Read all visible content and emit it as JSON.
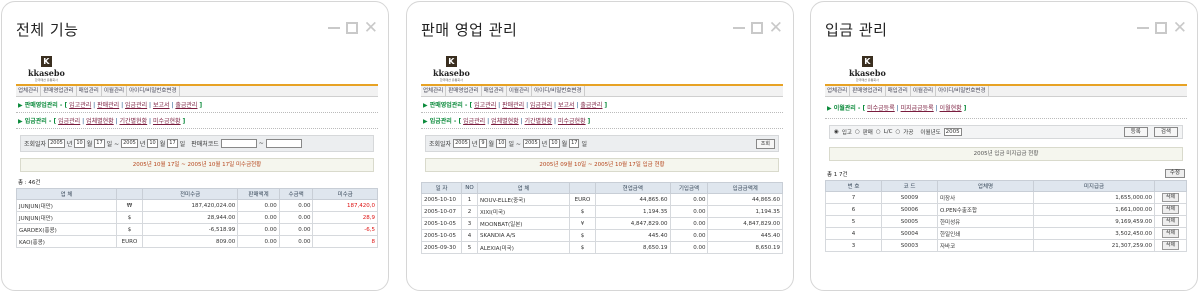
{
  "cards": [
    {
      "title": "전체 기능"
    },
    {
      "title": "판매 영업 관리"
    },
    {
      "title": "입금 관리"
    }
  ],
  "logo": {
    "mark": "K",
    "name": "kkasebo",
    "sub": "한국패션 유통회사"
  },
  "card1": {
    "menu": [
      "업체관리",
      "판매영업관리",
      "매입관리",
      "이월관리",
      "아이디/비밀번호변경"
    ],
    "nav1": {
      "prefix": "▶ 판매영업관리 - [",
      "items": [
        "입고관리",
        "판매관리",
        "입금관리",
        "보고서",
        "출금관리"
      ],
      "suffix": "]"
    },
    "nav2": {
      "prefix": "▶ 입금관리 - [",
      "items": [
        "입금관리",
        "업체별현황",
        "기간별현황",
        "미수금현황"
      ],
      "suffix": "]"
    },
    "filter": {
      "label": "조회일자",
      "y1": "2005",
      "m1": "10",
      "d1": "17",
      "y2": "2005",
      "m2": "10",
      "d2": "17",
      "code_label": "판매처코드",
      "tilde": "~"
    },
    "status": "2005년 10월 17일 ~ 2005년 10월 17일 미수금현황",
    "count": "총 : 46건",
    "columns": [
      "업 체",
      "",
      "전미수금",
      "판매액계",
      "수금액",
      "미수금"
    ],
    "rows": [
      [
        "JUNJUN(대만)",
        "₩",
        "187,420,024.00",
        "0.00",
        "0.00",
        "187,420,0"
      ],
      [
        "JUNJUN(대만)",
        "$",
        "28,944.00",
        "0.00",
        "0.00",
        "28,9"
      ],
      [
        "GARDEX(홍콩)",
        "$",
        "-6,518.99",
        "0.00",
        "0.00",
        "-6,5"
      ],
      [
        "KAO(홍콩)",
        "EURO",
        "809.00",
        "0.00",
        "0.00",
        "8"
      ]
    ]
  },
  "card2": {
    "menu": [
      "업체관리",
      "판매영업관리",
      "매입관리",
      "이월관리",
      "아이디/비밀번호변경"
    ],
    "nav1": {
      "prefix": "▶ 판매영업관리 - [",
      "items": [
        "입고관리",
        "판매관리",
        "입금관리",
        "보고서",
        "출금관리"
      ],
      "suffix": "]"
    },
    "nav2": {
      "prefix": "▶ 입금관리 - [",
      "items": [
        "입금관리",
        "업체별현황",
        "기간별현황",
        "미수금현황"
      ],
      "suffix": "]"
    },
    "filter": {
      "label": "조회일자",
      "y1": "2005",
      "m1": "9",
      "d1": "10",
      "y2": "2005",
      "m2": "10",
      "d2": "17",
      "btn": "조회"
    },
    "status": "2005년 09월 10일 ~ 2005년 10월 17일 입금 현황",
    "columns": [
      "일 자",
      "NO",
      "업 체",
      "",
      "현업금액",
      "기입금액",
      "입금금액계"
    ],
    "rows": [
      [
        "2005-10-10",
        "1",
        "NOUV-ELLE(중국)",
        "EURO",
        "44,865.60",
        "0.00",
        "44,865.60"
      ],
      [
        "2005-10-07",
        "2",
        "XIXI(미국)",
        "$",
        "1,194.35",
        "0.00",
        "1,194.35"
      ],
      [
        "2005-10-05",
        "3",
        "MOONBAT(일본)",
        "¥",
        "4,847,829.00",
        "0.00",
        "4,847,829.00"
      ],
      [
        "2005-10-05",
        "4",
        "SKANDIA A/S",
        "$",
        "445.40",
        "0.00",
        "445.40"
      ],
      [
        "2005-09-30",
        "5",
        "ALEXIA(미국)",
        "$",
        "8,650.19",
        "0.00",
        "8,650.19"
      ]
    ]
  },
  "card3": {
    "menu": [
      "업체관리",
      "판매영업관리",
      "매입관리",
      "이월관리",
      "아이디/비밀번호변경"
    ],
    "nav1": {
      "prefix": "▶ 이월관리 - [",
      "items": [
        "미수금등록",
        "미지급금등록",
        "이월현황"
      ],
      "suffix": "]"
    },
    "radio": {
      "opts": [
        "입고",
        "판매",
        "L/C",
        "가공"
      ],
      "year_label": "이월년도",
      "year": "2005",
      "b1": "등록",
      "b2": "검색"
    },
    "status": "2005년 입금 미지급금 현황",
    "count": "총 1 7건",
    "count_btn": "수정",
    "columns": [
      "번 호",
      "코 드",
      "업체명",
      "미지급금",
      ""
    ],
    "rows": [
      [
        "7",
        "S0009",
        "미장사",
        "1,655,000.00",
        "삭제"
      ],
      [
        "6",
        "S0006",
        "O.PEN수출조합",
        "1,661,000.00",
        "삭제"
      ],
      [
        "5",
        "S0005",
        "한미성유",
        "9,169,459.00",
        "삭제"
      ],
      [
        "4",
        "S0004",
        "한일인쇄",
        "3,502,450.00",
        "삭제"
      ],
      [
        "3",
        "S0003",
        "자바코",
        "21,307,259.00",
        "삭제"
      ]
    ]
  }
}
